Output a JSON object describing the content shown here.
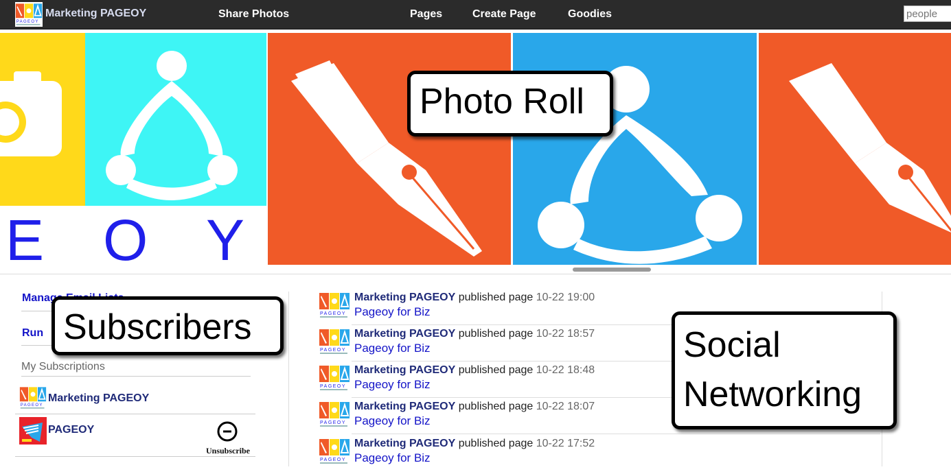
{
  "topbar": {
    "brand": "Marketing PAGEOY",
    "nav": [
      "Share Photos",
      "Pages",
      "Create Page",
      "Goodies"
    ],
    "search_placeholder": "people"
  },
  "photo_roll": {
    "callout": "Photo Roll",
    "banner_letters": [
      "E",
      "O",
      "Y"
    ],
    "colors": {
      "yellow": "#FFD91A",
      "cyan": "#3EF5F5",
      "orange": "#F05A28",
      "blue": "#29A7EA",
      "letter_blue": "#1F1FEA"
    }
  },
  "sidebar": {
    "links": [
      "Manage Email Lists",
      "Run"
    ],
    "callout": "Subscribers",
    "my_subscriptions_label": "My Subscriptions",
    "subscriptions": [
      {
        "name": "Marketing PAGEOY"
      },
      {
        "name": "PAGEOY",
        "action": "Unsubscribe"
      }
    ]
  },
  "feed": {
    "callout_line1": "Social",
    "callout_line2": "Networking",
    "items": [
      {
        "who": "Marketing PAGEOY",
        "action": "published page",
        "time": "10-22 19:00",
        "page": "Pageoy for Biz"
      },
      {
        "who": "Marketing PAGEOY",
        "action": "published page",
        "time": "10-22 18:57",
        "page": "Pageoy for Biz"
      },
      {
        "who": "Marketing PAGEOY",
        "action": "published page",
        "time": "10-22 18:48",
        "page": "Pageoy for Biz"
      },
      {
        "who": "Marketing PAGEOY",
        "action": "published page",
        "time": "10-22 18:07",
        "page": "Pageoy for Biz"
      },
      {
        "who": "Marketing PAGEOY",
        "action": "published page",
        "time": "10-22 17:52",
        "page": "Pageoy for Biz"
      }
    ]
  }
}
